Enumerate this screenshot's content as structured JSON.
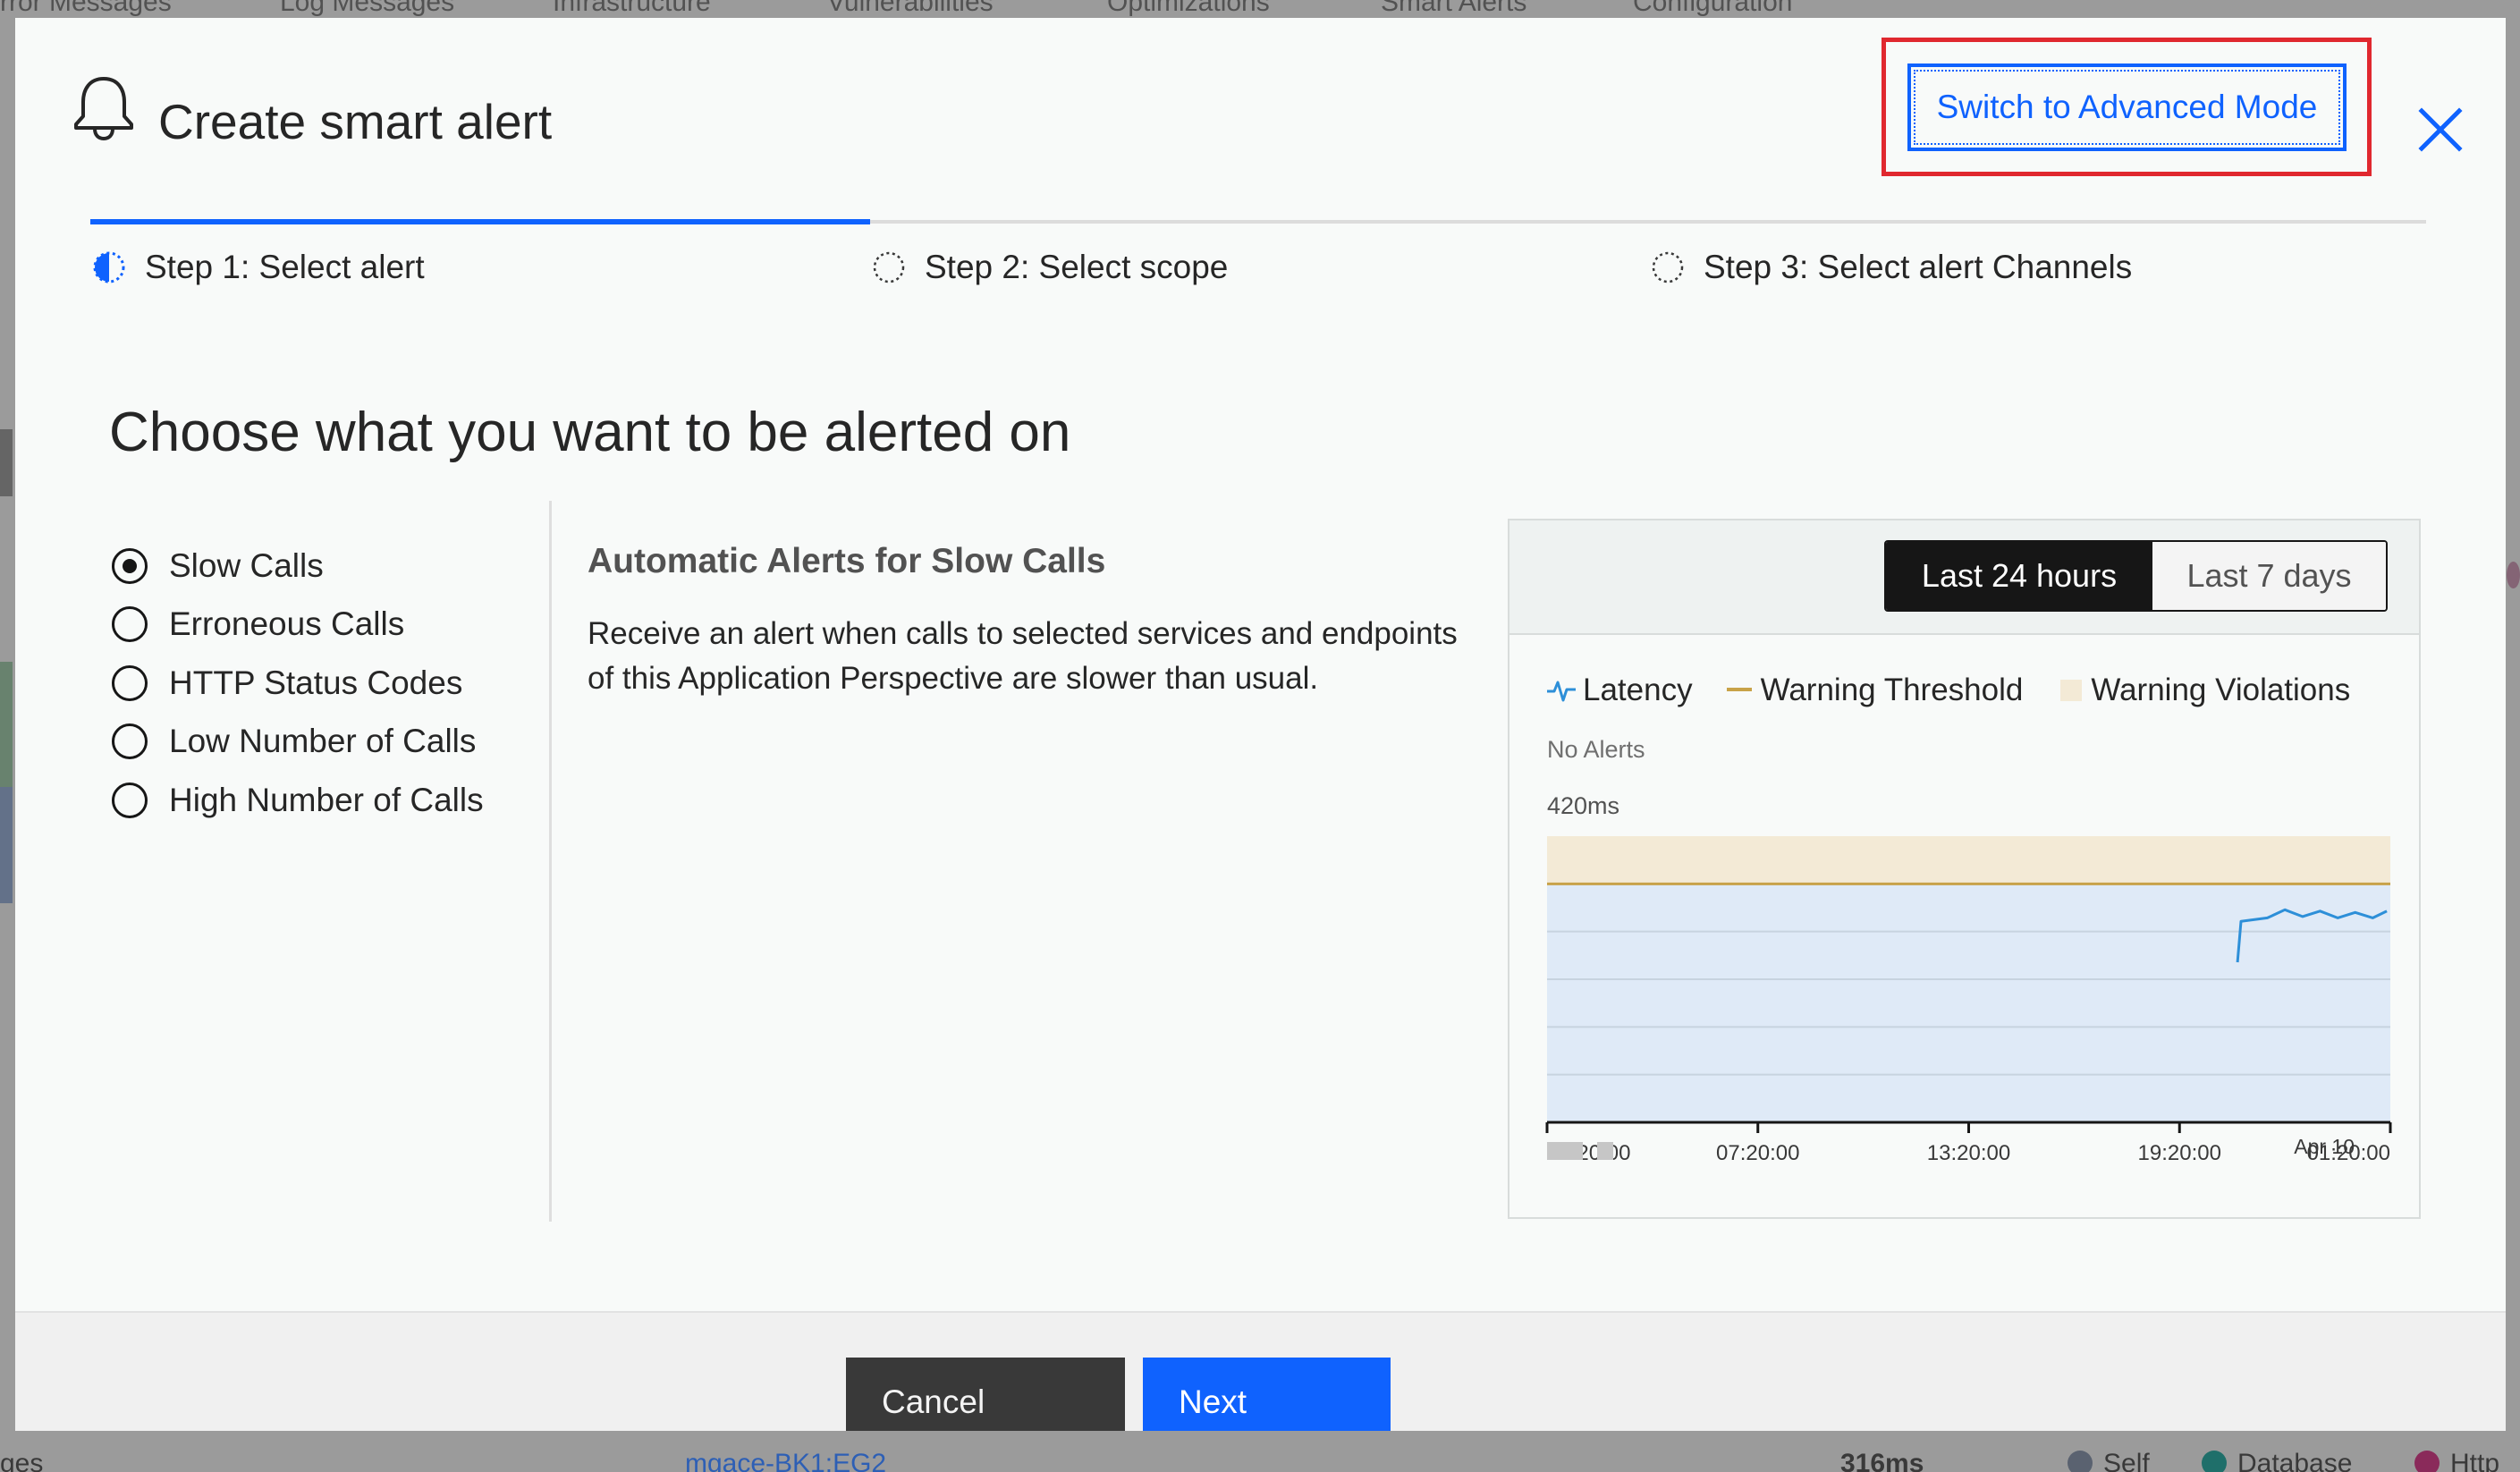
{
  "background": {
    "nav_tabs": [
      "rror Messages",
      "Log Messages",
      "Infrastructure",
      "Vulnerabilities",
      "Optimizations",
      "Smart Alerts",
      "Configuration"
    ],
    "bottom_left": "ges",
    "bottom_link": "mgace-BK1:EG2",
    "bottom_value": "316ms",
    "bottom_legend": [
      "Self",
      "Database",
      "Http"
    ]
  },
  "modal": {
    "title": "Create smart alert",
    "advanced_button": "Switch to Advanced Mode",
    "close_icon": "close-icon",
    "steps": [
      {
        "label": "Step 1: Select alert",
        "state": "in-progress"
      },
      {
        "label": "Step 2: Select scope",
        "state": "not-started"
      },
      {
        "label": "Step 3: Select alert Channels",
        "state": "not-started"
      }
    ],
    "heading": "Choose what you want to be alerted on",
    "options": [
      {
        "label": "Slow Calls",
        "checked": true
      },
      {
        "label": "Erroneous Calls",
        "checked": false
      },
      {
        "label": "HTTP Status Codes",
        "checked": false
      },
      {
        "label": "Low Number of Calls",
        "checked": false
      },
      {
        "label": "High Number of Calls",
        "checked": false
      }
    ],
    "description": {
      "title": "Automatic Alerts for Slow Calls",
      "text": "Receive an alert when calls to selected services and endpoints of this Application Perspective are slower than usual."
    },
    "chart": {
      "range_options": [
        "Last 24 hours",
        "Last 7 days"
      ],
      "selected_range": "Last 24 hours",
      "legend": [
        "Latency",
        "Warning Threshold",
        "Warning Violations"
      ],
      "no_alerts": "No Alerts",
      "y_label": "420ms",
      "x_ticks": [
        "01:20:00",
        "07:20:00",
        "13:20:00",
        "19:20:00",
        "01:20:00"
      ],
      "x_date": "Apr 10"
    },
    "footer": {
      "cancel": "Cancel",
      "next": "Next"
    }
  },
  "colors": {
    "primary": "#0f62fe",
    "latency": "#2d8fd8",
    "threshold": "#c8a248",
    "violation_band": "#f3ead6",
    "area_fill": "#dfeaf7",
    "highlight": "#e0282f"
  },
  "chart_data": {
    "type": "line",
    "title": "",
    "xlabel": "",
    "ylabel": "",
    "x_ticks": [
      "01:20:00",
      "07:20:00",
      "13:20:00",
      "19:20:00",
      "01:20:00"
    ],
    "x_date_label": "Apr 10",
    "ylim_top_label": "420ms",
    "ylim": [
      0,
      420
    ],
    "grid": true,
    "legend_position": "top-left",
    "series": [
      {
        "name": "Latency",
        "x_hours": [
          19.65,
          19.75,
          20.5,
          21.0,
          21.5,
          22.0,
          22.5,
          23.0,
          23.5,
          23.9
        ],
        "values": [
          235,
          295,
          300,
          312,
          302,
          310,
          300,
          308,
          300,
          310
        ]
      },
      {
        "name": "Warning Threshold",
        "value": 350
      }
    ],
    "violation_band": [
      350,
      420
    ]
  }
}
